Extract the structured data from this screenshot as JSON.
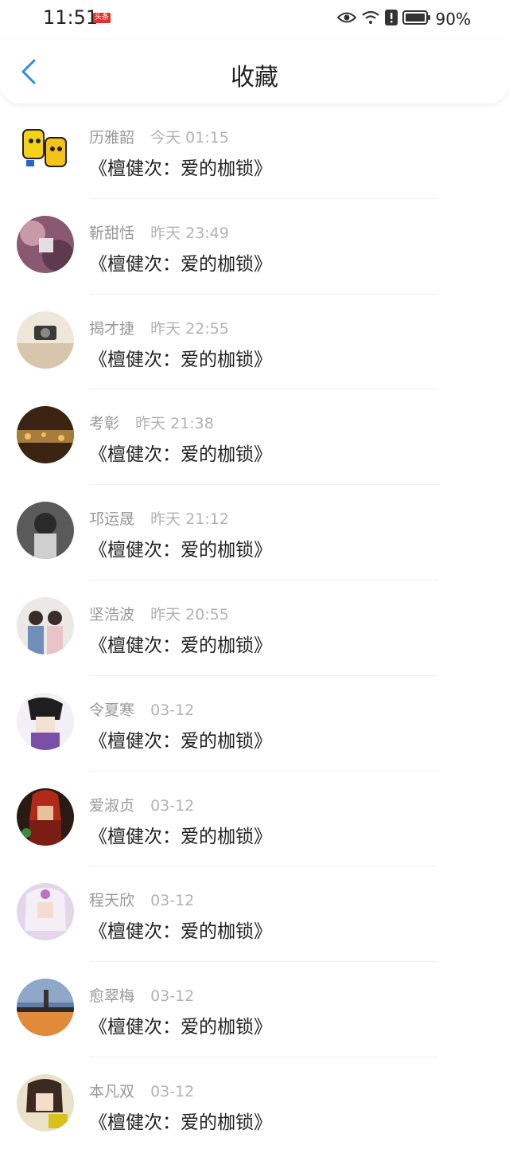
{
  "status": {
    "time": "11:51",
    "badge": "头条",
    "battery": "90%"
  },
  "header": {
    "title": "收藏"
  },
  "favorites": [
    {
      "name": "历雅韶",
      "time": "今天 01:15",
      "title": "《檀健次：爱的枷锁》"
    },
    {
      "name": "靳甜恬",
      "time": "昨天 23:49",
      "title": "《檀健次：爱的枷锁》"
    },
    {
      "name": "揭才捷",
      "time": "昨天 22:55",
      "title": "《檀健次：爱的枷锁》"
    },
    {
      "name": "考彰",
      "time": "昨天 21:38",
      "title": "《檀健次：爱的枷锁》"
    },
    {
      "name": "邛运晟",
      "time": "昨天 21:12",
      "title": "《檀健次：爱的枷锁》"
    },
    {
      "name": "坚浩波",
      "time": "昨天 20:55",
      "title": "《檀健次：爱的枷锁》"
    },
    {
      "name": "令夏寒",
      "time": "03-12",
      "title": "《檀健次：爱的枷锁》"
    },
    {
      "name": "爱淑贞",
      "time": "03-12",
      "title": "《檀健次：爱的枷锁》"
    },
    {
      "name": "程天欣",
      "time": "03-12",
      "title": "《檀健次：爱的枷锁》"
    },
    {
      "name": "愈翠梅",
      "time": "03-12",
      "title": "《檀健次：爱的枷锁》"
    },
    {
      "name": "本凡双",
      "time": "03-12",
      "title": "《檀健次：爱的枷锁》"
    }
  ],
  "colors": {
    "accent": "#2a8fe6"
  }
}
